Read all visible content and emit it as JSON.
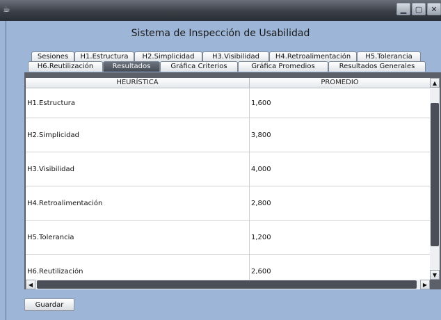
{
  "window": {
    "icon": "coffee-cup-icon",
    "controls": [
      "minimize",
      "maximize",
      "close"
    ]
  },
  "app": {
    "title": "Sistema de Inspección de Usabilidad"
  },
  "tabs": {
    "row1": [
      {
        "label": "Sesiones"
      },
      {
        "label": "H1.Estructura"
      },
      {
        "label": "H2.Simplicidad"
      },
      {
        "label": "H3.Visibilidad"
      },
      {
        "label": "H4.Retroalimentación"
      },
      {
        "label": "H5.Tolerancia"
      }
    ],
    "row2": [
      {
        "label": "H6.Reutilización"
      },
      {
        "label": "Resultados",
        "active": true
      },
      {
        "label": "Gráfica Criterios"
      },
      {
        "label": "Gráfica Promedios"
      },
      {
        "label": "Resultados Generales"
      }
    ]
  },
  "table": {
    "columns": [
      "HEURÍSTICA",
      "PROMEDIO"
    ],
    "rows": [
      [
        "H1.Estructura",
        "1,600"
      ],
      [
        "H2.Simplicidad",
        "3,800"
      ],
      [
        "H3.Visibilidad",
        "4,000"
      ],
      [
        "H4.Retroalimentación",
        "2,800"
      ],
      [
        "H5.Tolerancia",
        "1,200"
      ],
      [
        "H6.Reutilización",
        "2,600"
      ]
    ]
  },
  "footer": {
    "save_label": "Guardar"
  }
}
